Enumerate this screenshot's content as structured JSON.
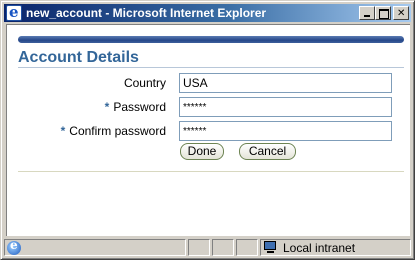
{
  "window": {
    "title": "new_account - Microsoft Internet Explorer"
  },
  "page": {
    "title": "Account Details",
    "required_marker": "*"
  },
  "form": {
    "country": {
      "label": "Country",
      "value": "USA"
    },
    "password": {
      "label": "Password",
      "value": "******"
    },
    "confirm_password": {
      "label": "Confirm password",
      "value": "******"
    }
  },
  "buttons": {
    "done": "Done",
    "cancel": "Cancel"
  },
  "statusbar": {
    "zone": "Local intranet"
  },
  "icons": {
    "app": "internet-explorer-icon",
    "page": "ie-page-icon",
    "zone": "local-intranet-icon"
  },
  "colors": {
    "titlebar_start": "#0a246a",
    "titlebar_end": "#a6caf0",
    "heading": "#336699",
    "header_bar": "#26488a"
  }
}
